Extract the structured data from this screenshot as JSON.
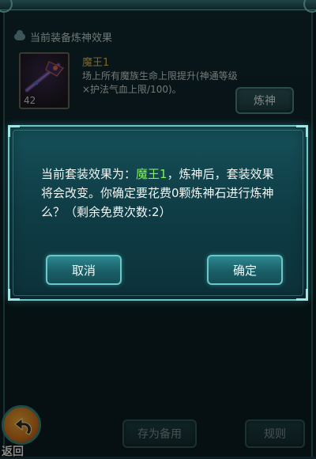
{
  "panel": {
    "section_title": "当前装备炼神效果",
    "equipment": {
      "name": "魔王1",
      "level": "42",
      "description": "场上所有魔族生命上限提升(神通等级×护法气血上限/100)。"
    },
    "refine_button": "炼神",
    "ghost_text": "",
    "save_button": "存为备用",
    "rules_button": "规则",
    "back_label": "返回"
  },
  "dialog": {
    "message_prefix": "当前套装效果为：",
    "set_name": "魔王1",
    "message_suffix": "，炼神后，套装效果将会改变。你确定要花费0颗炼神石进行炼神么？（剩余免费次数:2）",
    "cancel_label": "取消",
    "confirm_label": "确定"
  },
  "colors": {
    "item_name": "#e8b94a",
    "highlight": "#7ff05a",
    "dialog_border": "#6fc6c6"
  },
  "icons": {
    "section": "cloud-icon",
    "item": "weapon-icon",
    "back": "return-arrow-icon"
  }
}
